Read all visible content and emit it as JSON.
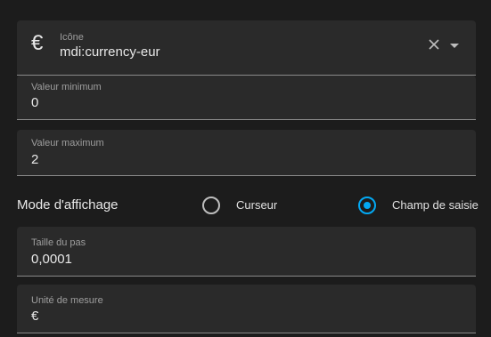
{
  "icon_field": {
    "label": "Icône",
    "value": "mdi:currency-eur",
    "icon_glyph": "€",
    "icon": "currency-eur-icon"
  },
  "min_field": {
    "label": "Valeur minimum",
    "value": "0"
  },
  "max_field": {
    "label": "Valeur maximum",
    "value": "2"
  },
  "display_mode": {
    "title": "Mode d'affichage",
    "options": [
      {
        "label": "Curseur",
        "selected": false
      },
      {
        "label": "Champ de saisie",
        "selected": true
      }
    ]
  },
  "step_field": {
    "label": "Taille du pas",
    "value": "0,0001"
  },
  "unit_field": {
    "label": "Unité de mesure",
    "value": "€"
  },
  "colors": {
    "accent": "#03a9f4",
    "background": "#1c1c1c",
    "field": "#2a2a2a"
  }
}
